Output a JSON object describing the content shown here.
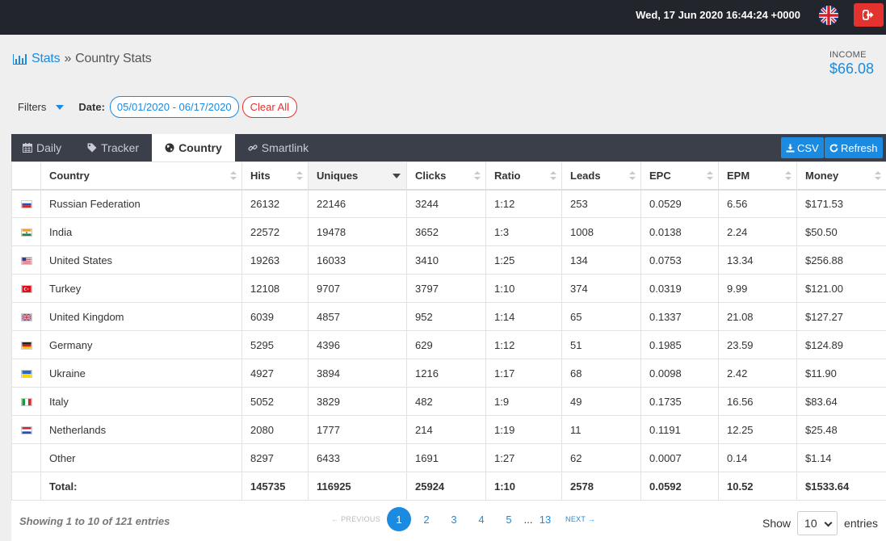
{
  "topbar": {
    "datetime": "Wed, 17 Jun 2020 16:44:24 +0000",
    "language_icon": "uk-flag-icon",
    "logout_icon": "logout-icon"
  },
  "breadcrumb": {
    "icon": "bar-chart-icon",
    "root": "Stats",
    "separator": "»",
    "current": "Country Stats"
  },
  "income": {
    "label": "INCOME",
    "value": "$66.08"
  },
  "filters": {
    "toggle_label": "Filters",
    "date_label": "Date:",
    "date_range": "05/01/2020 - 06/17/2020",
    "clear_label": "Clear All"
  },
  "tabs": [
    {
      "label": "Daily",
      "icon": "calendar-icon",
      "active": false
    },
    {
      "label": "Tracker",
      "icon": "tag-icon",
      "active": false
    },
    {
      "label": "Country",
      "icon": "globe-icon",
      "active": true
    },
    {
      "label": "Smartlink",
      "icon": "link-icon",
      "active": false
    }
  ],
  "toolbar": {
    "csv_label": "CSV",
    "refresh_label": "Refresh"
  },
  "table": {
    "columns": [
      "",
      "Country",
      "Hits",
      "Uniques",
      "Clicks",
      "Ratio",
      "Leads",
      "EPC",
      "EPM",
      "Money"
    ],
    "sorted_column": "Uniques",
    "rows": [
      {
        "flag": "ru",
        "country": "Russian Federation",
        "hits": "26132",
        "uniques": "22146",
        "clicks": "3244",
        "ratio": "1:12",
        "leads": "253",
        "epc": "0.0529",
        "epm": "6.56",
        "money": "$171.53"
      },
      {
        "flag": "in",
        "country": "India",
        "hits": "22572",
        "uniques": "19478",
        "clicks": "3652",
        "ratio": "1:3",
        "leads": "1008",
        "epc": "0.0138",
        "epm": "2.24",
        "money": "$50.50"
      },
      {
        "flag": "us",
        "country": "United States",
        "hits": "19263",
        "uniques": "16033",
        "clicks": "3410",
        "ratio": "1:25",
        "leads": "134",
        "epc": "0.0753",
        "epm": "13.34",
        "money": "$256.88"
      },
      {
        "flag": "tr",
        "country": "Turkey",
        "hits": "12108",
        "uniques": "9707",
        "clicks": "3797",
        "ratio": "1:10",
        "leads": "374",
        "epc": "0.0319",
        "epm": "9.99",
        "money": "$121.00"
      },
      {
        "flag": "gb",
        "country": "United Kingdom",
        "hits": "6039",
        "uniques": "4857",
        "clicks": "952",
        "ratio": "1:14",
        "leads": "65",
        "epc": "0.1337",
        "epm": "21.08",
        "money": "$127.27"
      },
      {
        "flag": "de",
        "country": "Germany",
        "hits": "5295",
        "uniques": "4396",
        "clicks": "629",
        "ratio": "1:12",
        "leads": "51",
        "epc": "0.1985",
        "epm": "23.59",
        "money": "$124.89"
      },
      {
        "flag": "ua",
        "country": "Ukraine",
        "hits": "4927",
        "uniques": "3894",
        "clicks": "1216",
        "ratio": "1:17",
        "leads": "68",
        "epc": "0.0098",
        "epm": "2.42",
        "money": "$11.90"
      },
      {
        "flag": "it",
        "country": "Italy",
        "hits": "5052",
        "uniques": "3829",
        "clicks": "482",
        "ratio": "1:9",
        "leads": "49",
        "epc": "0.1735",
        "epm": "16.56",
        "money": "$83.64"
      },
      {
        "flag": "nl",
        "country": "Netherlands",
        "hits": "2080",
        "uniques": "1777",
        "clicks": "214",
        "ratio": "1:19",
        "leads": "11",
        "epc": "0.1191",
        "epm": "12.25",
        "money": "$25.48"
      },
      {
        "flag": "",
        "country": "Other",
        "hits": "8297",
        "uniques": "6433",
        "clicks": "1691",
        "ratio": "1:27",
        "leads": "62",
        "epc": "0.0007",
        "epm": "0.14",
        "money": "$1.14"
      }
    ],
    "total": {
      "label": "Total:",
      "hits": "145735",
      "uniques": "116925",
      "clicks": "25924",
      "ratio": "1:10",
      "leads": "2578",
      "epc": "0.0592",
      "epm": "10.52",
      "money": "$1533.64"
    }
  },
  "footer": {
    "info": "Showing 1 to 10 of 121 entries",
    "prev_label": "← PREVIOUS",
    "next_label": "NEXT →",
    "pages": [
      "1",
      "2",
      "3",
      "4",
      "5"
    ],
    "ellipsis": "...",
    "last_page": "13",
    "current_page": "1",
    "show_label": "Show",
    "page_size": "10",
    "entries_label": "entries"
  },
  "colors": {
    "accent": "#1a8be0",
    "danger": "#e4322f",
    "topbar": "#22252b",
    "tabbar": "#3a3f4a"
  }
}
